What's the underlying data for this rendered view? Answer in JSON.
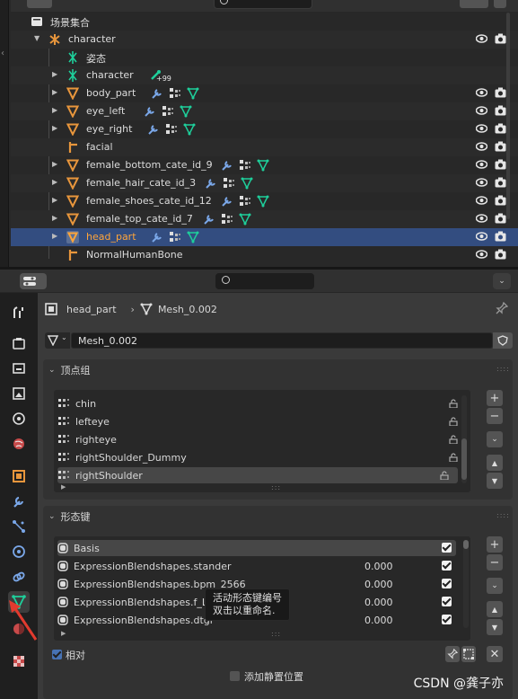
{
  "outliner": {
    "scene_collection": "场景集合",
    "rows": [
      {
        "label": "character",
        "icon": "armature-object-icon"
      },
      {
        "label": "姿态",
        "icon": "pose-icon"
      },
      {
        "label": "character",
        "icon": "armature-data-icon",
        "badge": "+99"
      },
      {
        "label": "body_part",
        "icon": "mesh-object-icon"
      },
      {
        "label": "eye_left",
        "icon": "mesh-object-icon"
      },
      {
        "label": "eye_right",
        "icon": "mesh-object-icon"
      },
      {
        "label": "facial",
        "icon": "bone-icon"
      },
      {
        "label": "female_bottom_cate_id_9",
        "icon": "mesh-object-icon"
      },
      {
        "label": "female_hair_cate_id_3",
        "icon": "mesh-object-icon"
      },
      {
        "label": "female_shoes_cate_id_12",
        "icon": "mesh-object-icon"
      },
      {
        "label": "female_top_cate_id_7",
        "icon": "mesh-object-icon"
      },
      {
        "label": "head_part",
        "icon": "mesh-object-icon"
      },
      {
        "label": "NormalHumanBone",
        "icon": "bone-icon"
      }
    ]
  },
  "properties": {
    "breadcrumb": {
      "object": "head_part",
      "mesh": "Mesh_0.002"
    },
    "mesh_datablock": "Mesh_0.002",
    "vertex_groups": {
      "title": "顶点组",
      "items": [
        "chin",
        "lefteye",
        "righteye",
        "rightShoulder_Dummy",
        "rightShoulder"
      ]
    },
    "shape_keys": {
      "title": "形态键",
      "items": [
        {
          "name": "Basis",
          "value": ""
        },
        {
          "name": "ExpressionBlendshapes.stander",
          "value": "0.000"
        },
        {
          "name": "ExpressionBlendshapes.bpm_2566",
          "value": "0.000"
        },
        {
          "name": "ExpressionBlendshapes.f_L_",
          "value": "0.000"
        },
        {
          "name": "ExpressionBlendshapes.dtgl",
          "value": "0.000"
        }
      ],
      "tooltip_line1": "活动形态键编号",
      "tooltip_line2": "双击以重命名.",
      "relative_label": "相对",
      "add_rest_label": "添加静置位置"
    }
  },
  "watermark": "CSDN @龚子亦",
  "colors": {
    "accent": "#4772b3",
    "selected_row": "#334d80",
    "selected_text": "#ffa53a",
    "mesh_green": "#1ecf9b",
    "object_orange": "#e8963c"
  }
}
